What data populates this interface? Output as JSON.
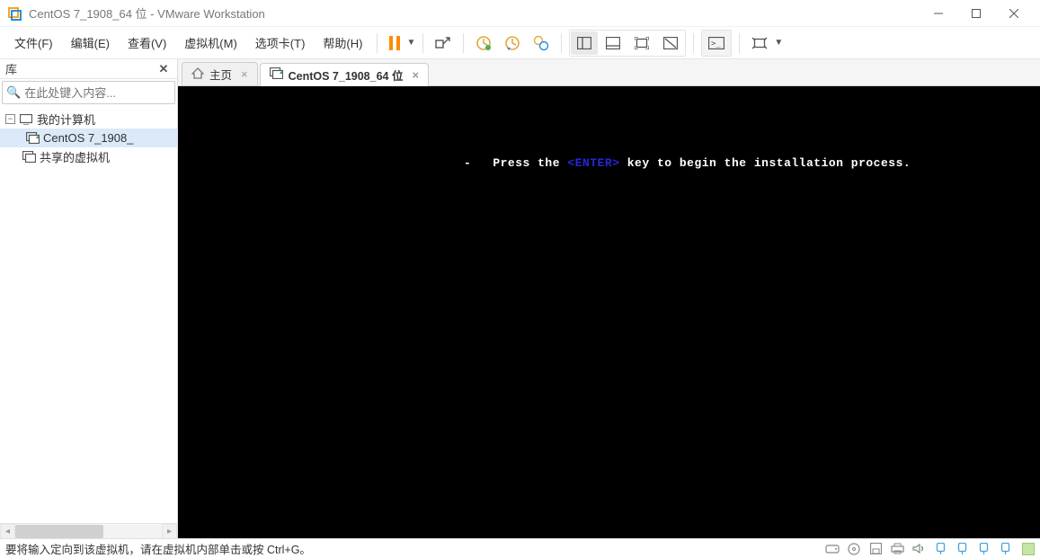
{
  "titlebar": {
    "title": "CentOS 7_1908_64 位 - VMware Workstation"
  },
  "menu": {
    "file": "文件(F)",
    "edit": "编辑(E)",
    "view": "查看(V)",
    "vm": "虚拟机(M)",
    "tabs": "选项卡(T)",
    "help": "帮助(H)"
  },
  "sidebar": {
    "title": "库",
    "search_placeholder": "在此处键入内容...",
    "tree": {
      "my_computer": "我的计算机",
      "vm_name": "CentOS 7_1908_",
      "shared": "共享的虚拟机"
    }
  },
  "tabs": {
    "home": "主页",
    "vm": "CentOS 7_1908_64 位"
  },
  "console": {
    "dash": "-",
    "press_the": "Press the ",
    "enter": "<ENTER>",
    "rest": " key to begin the installation process."
  },
  "statusbar": {
    "hint": "要将输入定向到该虚拟机，请在虚拟机内部单击或按 Ctrl+G。"
  }
}
